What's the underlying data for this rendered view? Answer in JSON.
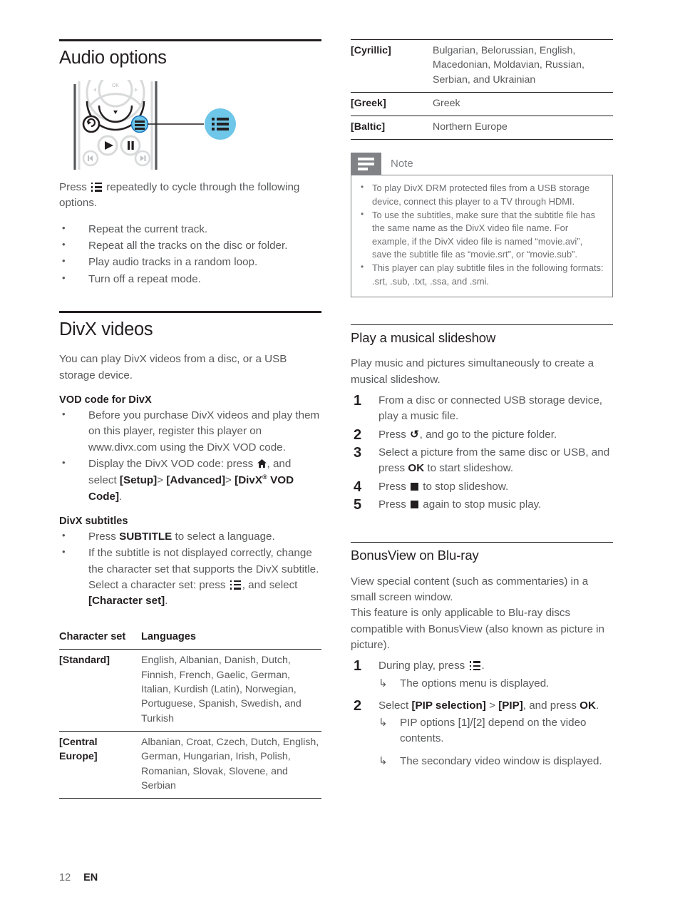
{
  "left_column": {
    "audio_options": {
      "heading": "Audio options",
      "figure": {
        "alt": "remote-control-options-button",
        "callout_icon": "options-list-icon",
        "accent_color": "#6ec6e8"
      },
      "intro_line1": "repeatedly to cycle through the",
      "intro_prefix": "Press",
      "intro_line2": "following options.",
      "bullets": [
        "Repeat the current track.",
        "Repeat all the tracks on the disc or folder.",
        "Play audio tracks in a random loop.",
        "Turn off a repeat mode."
      ]
    },
    "divx": {
      "heading": "DivX videos",
      "intro": "You can play DivX videos from a disc, or a USB storage device.",
      "vod_heading": "VOD code for DivX",
      "vod_bullet_1": "Before you purchase DivX videos and play them on this player, register this player on www.divx.com using the DivX VOD code.",
      "vod_bullet_2_a": "Display the DivX VOD code: press",
      "vod_bullet_2_b": ", and select",
      "vod_bullet_2_setup": "[Setup]",
      "vod_bullet_2_gt1": ">",
      "vod_bullet_2_advanced": "[Advanced]",
      "vod_bullet_2_gt2": ">",
      "vod_bullet_2_divx": "[DivX",
      "vod_bullet_2_reg": "®",
      "vod_bullet_2_code": "VOD Code]",
      "vod_bullet_2_period": ".",
      "subtitles_heading": "DivX subtitles",
      "sub_bullet_1_a": "Press",
      "sub_bullet_1_key": "SUBTITLE",
      "sub_bullet_1_b": "to select a language.",
      "sub_bullet_2_a": "If the subtitle is not displayed correctly, change the character set that supports the DivX subtitle. Select a character set: press",
      "sub_bullet_2_b": ", and select",
      "sub_bullet_2_charset": "[Character set]",
      "sub_bullet_2_period": "."
    },
    "charset_table": {
      "header_col1": "Character set",
      "header_col2": "Languages",
      "rows": [
        {
          "key": "[Standard]",
          "value": "English, Albanian, Danish, Dutch, Finnish, French, Gaelic, German, Italian, Kurdish (Latin), Norwegian, Portuguese, Spanish, Swedish, and Turkish"
        },
        {
          "key": "[Central Europe]",
          "value": "Albanian, Croat, Czech, Dutch, English, German, Hungarian, Irish, Polish, Romanian, Slovak, Slovene, and Serbian"
        }
      ]
    }
  },
  "right_column": {
    "charset_table_cont": {
      "rows": [
        {
          "key": "[Cyrillic]",
          "value": "Bulgarian, Belorussian, English, Macedonian, Moldavian, Russian, Serbian, and Ukrainian"
        },
        {
          "key": "[Greek]",
          "value": "Greek"
        },
        {
          "key": "[Baltic]",
          "value": "Northern Europe"
        }
      ]
    },
    "note": {
      "title": "Note",
      "icon": "note-lines-icon",
      "icon_bg": "#808285",
      "items": [
        "To play DivX DRM protected files from a USB storage device, connect this player to a TV through HDMI.",
        "To use the subtitles, make sure that the subtitle file has the same name as the DivX video file name. For example, if the DivX video file is named “movie.avi”, save the subtitle file as “movie.srt”, or “movie.sub”.",
        "This player can play subtitle files in the following formats: .srt, .sub, .txt, .ssa, and .smi."
      ]
    },
    "slideshow": {
      "heading": "Play a musical slideshow",
      "intro": "Play music and pictures simultaneously to create a musical slideshow.",
      "step1_num": "1",
      "step1_text": "From a disc or connected USB storage device, play a music file.",
      "step2_num": "2",
      "step2_a": "Press",
      "step2_glyph": "↺",
      "step2_b": ", and go to the picture folder.",
      "step3_num": "3",
      "step3_a": "Select a picture from the same disc or USB, and press",
      "step3_key": "OK",
      "step3_b": "to start slideshow.",
      "step4_num": "4",
      "step4_a": "Press",
      "step4_b": "to stop slideshow.",
      "step5_num": "5",
      "step5_a": "Press",
      "step5_b": "again to stop music play."
    },
    "bonusview": {
      "heading": "BonusView on Blu-ray",
      "intro_p1": "View special content (such as commentaries) in a small screen window.",
      "intro_p2": "This feature is only applicable to Blu-ray discs compatible with BonusView (also known as picture in picture).",
      "step1_num": "1",
      "step1_a": "During play, press",
      "step1_b": ".",
      "step1_sub": "The options menu is displayed.",
      "step2_num": "2",
      "step2_a": "Select",
      "step2_pip_selection": "[PIP selection]",
      "step2_gt": ">",
      "step2_pip": "[PIP]",
      "step2_b": ", and press",
      "step2_key": "OK",
      "step2_period": ".",
      "step2_sub1": "PIP options [1]/[2] depend on the video contents.",
      "step2_sub2": "The secondary video window is displayed."
    }
  },
  "footer": {
    "page_number": "12",
    "language": "EN"
  }
}
